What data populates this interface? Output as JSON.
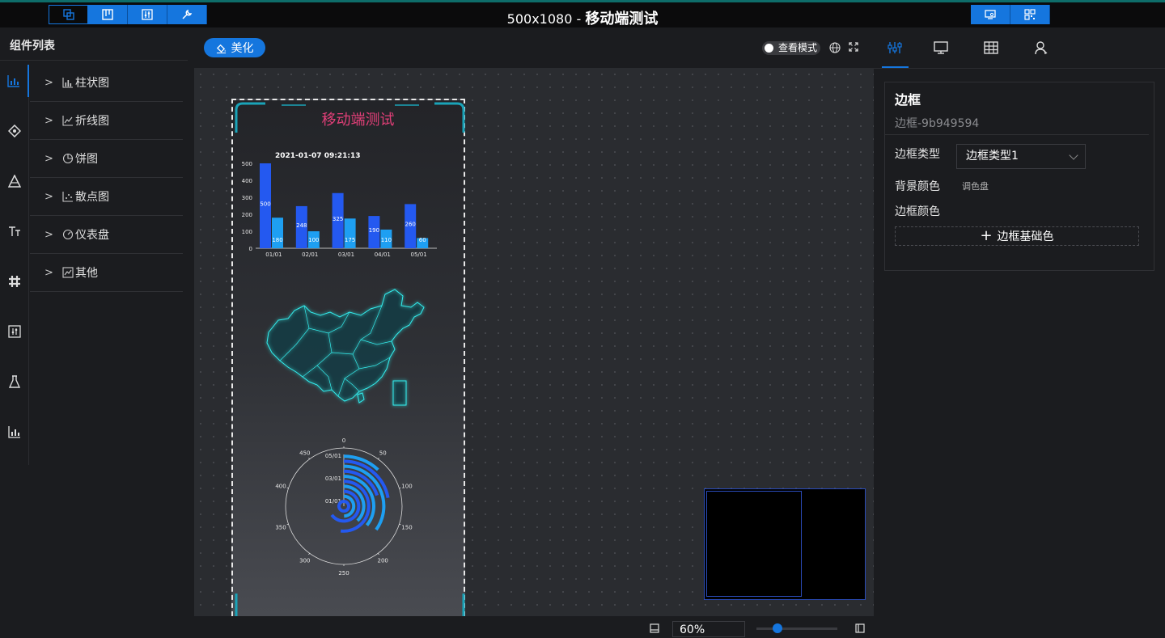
{
  "app": {
    "title_size": "500x1080 - ",
    "title_name": "移动端测试",
    "toolbar_left": [
      {
        "icon": "layers-icon"
      },
      {
        "icon": "kanban-icon"
      },
      {
        "icon": "sliders-icon"
      },
      {
        "icon": "wrench-icon"
      }
    ],
    "toolbar_right": [
      {
        "icon": "preview-screen-icon"
      },
      {
        "icon": "qrcode-icon"
      }
    ]
  },
  "left_panel": {
    "title": "组件列表",
    "side_icons": [
      "bar-chart-icon",
      "diamond-node-icon",
      "triangle-icon",
      "text-icon",
      "hash-icon",
      "sliders-box-icon",
      "flask-icon",
      "bar-chart-small-icon"
    ],
    "categories": [
      {
        "label": "柱状图",
        "icon": "bar-chart-icon"
      },
      {
        "label": "折线图",
        "icon": "line-chart-icon"
      },
      {
        "label": "饼图",
        "icon": "pie-chart-icon"
      },
      {
        "label": "散点图",
        "icon": "scatter-chart-icon"
      },
      {
        "label": "仪表盘",
        "icon": "gauge-icon"
      },
      {
        "label": "其他",
        "icon": "other-chart-icon"
      }
    ]
  },
  "center": {
    "beautify_label": "美化",
    "view_mode_label": "查看模式",
    "zoom_value": "60%"
  },
  "phone": {
    "title": "移动端测试",
    "timestamp": "2021-01-07 09:21:13"
  },
  "chart_data": [
    {
      "type": "bar",
      "categories": [
        "01/01",
        "02/01",
        "03/01",
        "04/01",
        "05/01"
      ],
      "series": [
        {
          "values": [
            500,
            248,
            325,
            190,
            260
          ],
          "color": "#2459f0"
        },
        {
          "values": [
            180,
            100,
            175,
            110,
            60
          ],
          "color": "#1e9ff2"
        }
      ],
      "ylim": [
        0,
        500
      ],
      "yticks": [
        "0",
        "100",
        "200",
        "300",
        "400",
        "500"
      ]
    },
    {
      "type": "polar-bar",
      "categories": [
        "01/01",
        "03/01",
        "05/01"
      ],
      "angle_ticks": [
        "0",
        "50",
        "100",
        "150",
        "200",
        "250",
        "300",
        "350",
        "400",
        "450"
      ],
      "angle_max": 500,
      "values": [
        {
          "radius_index": 0,
          "value": 500
        },
        {
          "radius_index": 1,
          "value": 248
        },
        {
          "radius_index": 2,
          "value": 325
        },
        {
          "radius_index": 3,
          "value": 190
        },
        {
          "radius_index": 4,
          "value": 260
        },
        {
          "radius_index": 5,
          "value": 180
        },
        {
          "radius_index": 6,
          "value": 100
        },
        {
          "radius_index": 7,
          "value": 175
        },
        {
          "radius_index": 8,
          "value": 110
        },
        {
          "radius_index": 9,
          "value": 60
        }
      ],
      "colors": [
        "#2459f0",
        "#1e9ff2"
      ]
    }
  ],
  "right_panel": {
    "tabs": [
      "sliders-tab-icon",
      "monitor-tab-icon",
      "table-tab-icon",
      "users-tab-icon"
    ],
    "heading": "边框",
    "component_id": "边框-9b949594",
    "border_type_label": "边框类型",
    "border_type_value": "边框类型1",
    "bg_color_label": "背景颜色",
    "palette_label": "调色盘",
    "border_color_label": "边框颜色",
    "add_color_label": "边框基础色"
  }
}
